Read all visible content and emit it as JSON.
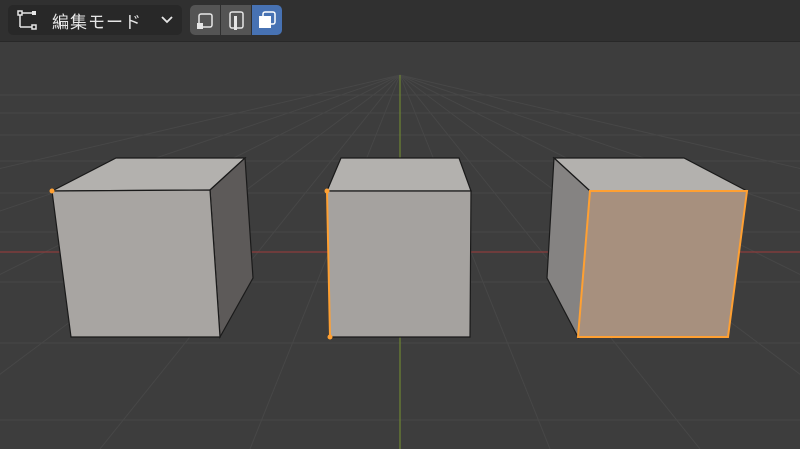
{
  "header": {
    "mode_label": "編集モード",
    "mode_icon": "edit-mode-icon",
    "select_modes": [
      {
        "name": "vertex-select",
        "icon": "vertex-select-icon",
        "active": false
      },
      {
        "name": "edge-select",
        "icon": "edge-select-icon",
        "active": false
      },
      {
        "name": "face-select",
        "icon": "face-select-icon",
        "active": true
      }
    ]
  },
  "colors": {
    "viewport_bg": "#3d3d3d",
    "grid_line": "#474747",
    "axis_x": "#8b3d3d",
    "axis_y": "#6e8532",
    "cube_face": "#a8a4a0",
    "selection": "#ffa032",
    "active_button": "#4772b3"
  }
}
